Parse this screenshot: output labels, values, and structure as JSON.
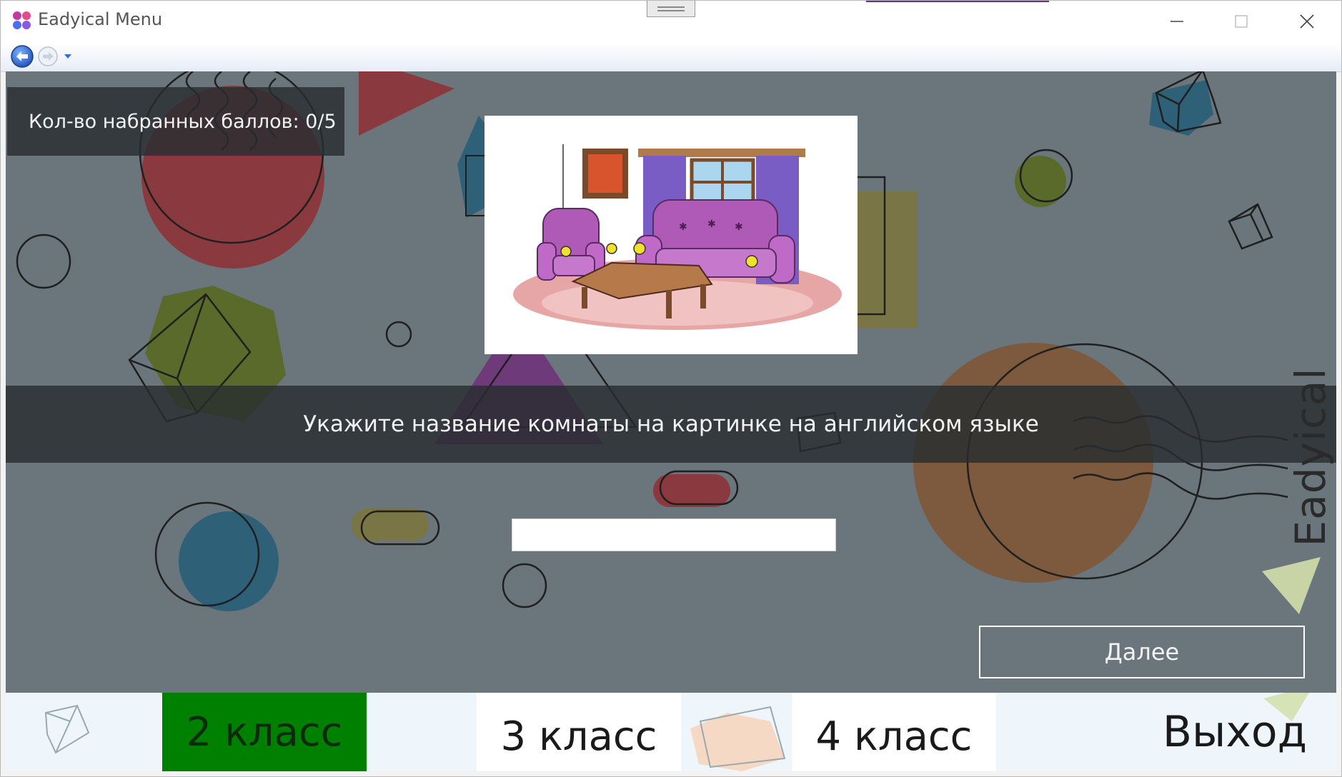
{
  "window": {
    "title": "Eadyical Menu",
    "controls": [
      "minimize-icon",
      "maximize-icon",
      "close-icon"
    ]
  },
  "navbar": {
    "back_icon": "arrow-left-icon",
    "forward_icon": "arrow-right-icon",
    "history_icon": "chevron-down-icon"
  },
  "quiz": {
    "score_text": "Кол-во набранных баллов: 0/5",
    "task_text": "Укажите название комнаты на картинке на английском языке",
    "answer_value": "",
    "next_label": "Далее",
    "picture_icon": "living-room-illustration"
  },
  "brand": {
    "vertical_text": "Eadyical"
  },
  "bottom_nav": {
    "grade_2": "2 класс",
    "grade_3": "3 класс",
    "grade_4": "4 класс",
    "exit": "Выход"
  },
  "colors": {
    "background": "#6b767c",
    "panel": "#282d30",
    "active_grade": "#008000",
    "nav_accent": "#2f6fd6"
  }
}
